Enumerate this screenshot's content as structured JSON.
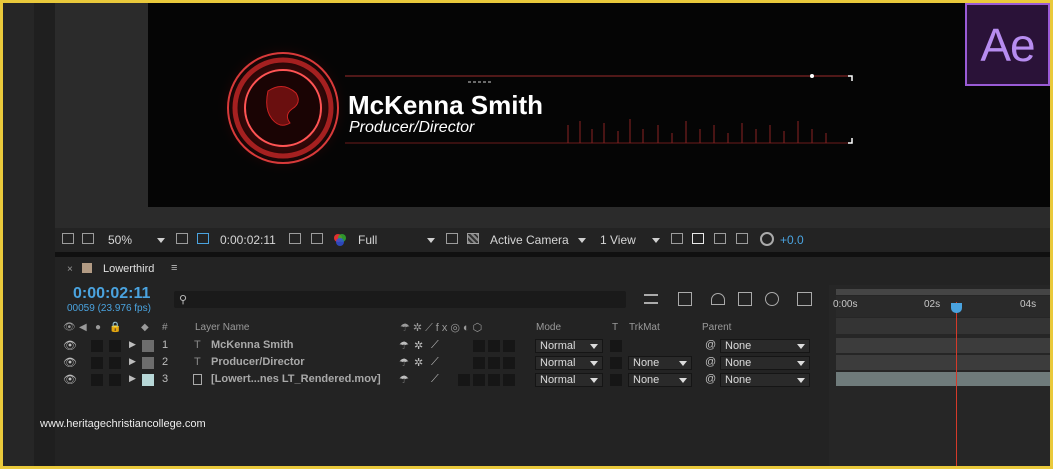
{
  "app": {
    "logo_text": "Ae"
  },
  "preview": {
    "name": "McKenna Smith",
    "title": "Producer/Director"
  },
  "viewer_toolbar": {
    "zoom": "50%",
    "timecode": "0:00:02:11",
    "resolution": "Full",
    "camera": "Active Camera",
    "views": "1 View",
    "exposure": "+0.0"
  },
  "timeline": {
    "tab_label": "Lowerthird",
    "tab_menu": "≡",
    "current_time": "0:00:02:11",
    "frame_info": "00059 (23.976 fps)",
    "ruler_labels": [
      "0:00s",
      "02s",
      "04s"
    ],
    "columns": {
      "num": "#",
      "layer_name": "Layer Name",
      "mode": "Mode",
      "t": "T",
      "trkmat": "TrkMat",
      "parent": "Parent"
    },
    "layers": [
      {
        "num": "1",
        "type": "text",
        "name": "McKenna Smith",
        "mode": "Normal",
        "trkmat": "",
        "parent": "None",
        "color": "#6d6d6d"
      },
      {
        "num": "2",
        "type": "text",
        "name": "Producer/Director",
        "mode": "Normal",
        "trkmat": "None",
        "parent": "None",
        "color": "#6d6d6d"
      },
      {
        "num": "3",
        "type": "footage",
        "name": "[Lowert...nes LT_Rendered.mov]",
        "mode": "Normal",
        "trkmat": "None",
        "parent": "None",
        "color": "#b7d7d7"
      }
    ]
  },
  "watermark": "www.heritagechristiancollege.com",
  "colors": {
    "accent_blue": "#4aa3df",
    "playhead": "#d43a2a",
    "frame": "#e9c93b",
    "ae_purple": "#9a5bd6"
  }
}
